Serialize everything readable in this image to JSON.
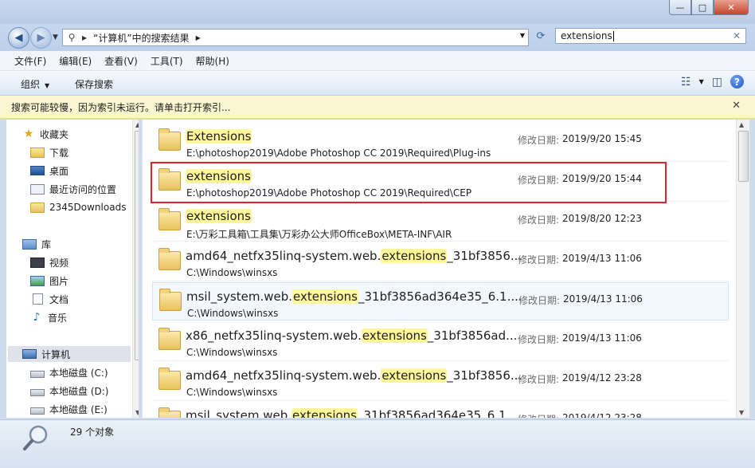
{
  "window": {
    "minimize_glyph": "—",
    "maximize_glyph": "□",
    "close_glyph": "✕"
  },
  "address": {
    "path": "“计算机”中的搜索结果",
    "search_value": "extensions"
  },
  "menu": [
    "文件(F)",
    "编辑(E)",
    "查看(V)",
    "工具(T)",
    "帮助(H)"
  ],
  "toolbar": {
    "organize": "组织",
    "save_search": "保存搜索",
    "help": "?"
  },
  "infobar": {
    "message": "搜索可能较慢，因为索引未运行。请单击打开索引..."
  },
  "sidebar": {
    "favorites_header": "收藏夹",
    "favorites": [
      "下载",
      "桌面",
      "最近访问的位置",
      "2345Downloads"
    ],
    "libraries_header": "库",
    "libraries": [
      "视频",
      "图片",
      "文档",
      "音乐"
    ],
    "computer_header": "计算机",
    "drives": [
      "本地磁盘 (C:)",
      "本地磁盘 (D:)",
      "本地磁盘 (E:)"
    ]
  },
  "results": [
    {
      "pre": "",
      "match": "Extensions",
      "post": "",
      "path": "E:\\photoshop2019\\Adobe Photoshop CC 2019\\Required\\Plug-ins",
      "date_label": "修改日期:",
      "date": "2019/9/20 15:45"
    },
    {
      "pre": "",
      "match": "extensions",
      "post": "",
      "path": "E:\\photoshop2019\\Adobe Photoshop CC 2019\\Required\\CEP",
      "date_label": "修改日期:",
      "date": "2019/9/20 15:44"
    },
    {
      "pre": "",
      "match": "extensions",
      "post": "",
      "path": "E:\\万彩工具箱\\工具集\\万彩办公大师OfficeBox\\META-INF\\AIR",
      "date_label": "修改日期:",
      "date": "2019/8/20 12:23"
    },
    {
      "pre": "amd64_netfx35linq-system.web.",
      "match": "extensions",
      "post": "_31bf3856...",
      "path": "C:\\Windows\\winsxs",
      "date_label": "修改日期:",
      "date": "2019/4/13 11:06"
    },
    {
      "pre": "msil_system.web.",
      "match": "extensions",
      "post": "_31bf3856ad364e35_6.1....",
      "path": "C:\\Windows\\winsxs",
      "date_label": "修改日期:",
      "date": "2019/4/13 11:06"
    },
    {
      "pre": "x86_netfx35linq-system.web.",
      "match": "extensions",
      "post": "_31bf3856ad...",
      "path": "C:\\Windows\\winsxs",
      "date_label": "修改日期:",
      "date": "2019/4/13 11:06"
    },
    {
      "pre": "amd64_netfx35linq-system.web.",
      "match": "extensions",
      "post": "_31bf3856...",
      "path": "C:\\Windows\\winsxs",
      "date_label": "修改日期:",
      "date": "2019/4/12 23:28"
    },
    {
      "pre": "msil_system.web.",
      "match": "extensions",
      "post": "_31bf3856ad364e35_6.1....",
      "path": "",
      "date_label": "修改日期:",
      "date": "2019/4/12 23:28"
    }
  ],
  "status": {
    "count": "29 个对象"
  }
}
